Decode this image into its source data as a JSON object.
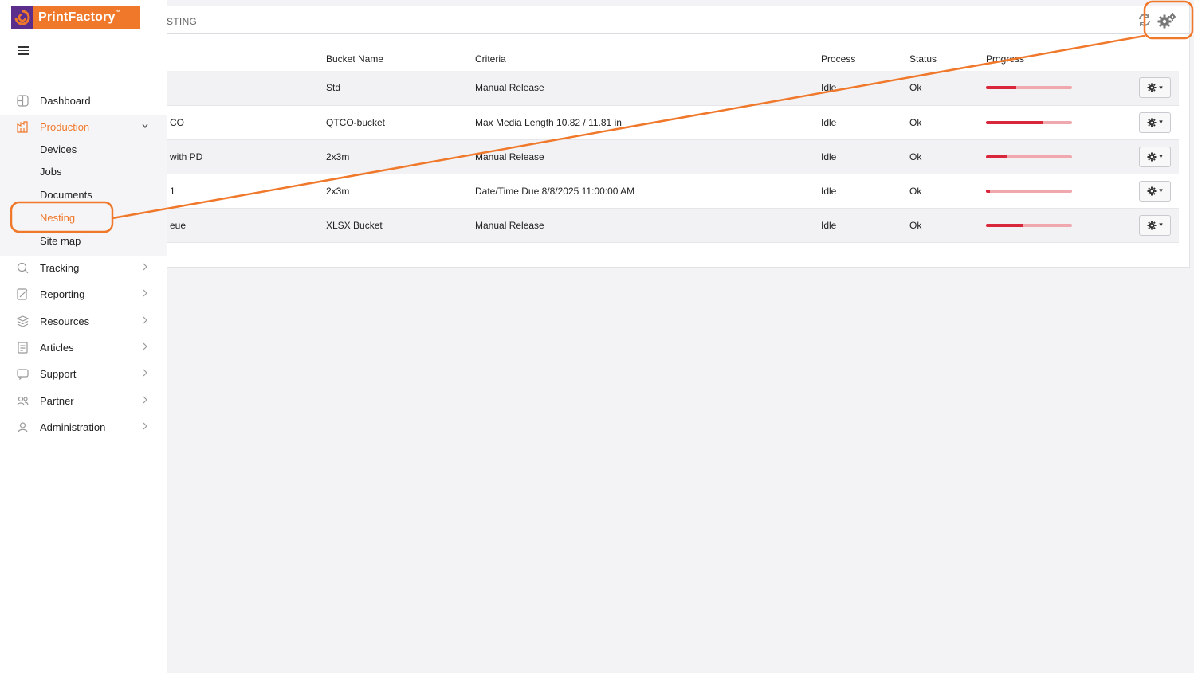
{
  "brand": {
    "name": "PrintFactory",
    "tm": "™",
    "orange": "#f0782b",
    "purple": "#5b2e8c"
  },
  "breadcrumb": "STING",
  "toolbar": {
    "refresh_icon": "refresh-icon",
    "settings_icon": "gears-icon"
  },
  "table": {
    "headers": [
      "Bucket Name",
      "Criteria",
      "Process",
      "Status",
      "Progress"
    ],
    "rows": [
      {
        "name": "",
        "bucket": "Std",
        "criteria": "Manual Release",
        "process": "Idle",
        "status": "Ok",
        "progress": 0.35
      },
      {
        "name": "CO",
        "bucket": "QTCO-bucket",
        "criteria": "Max Media Length 10.82 / 11.81 in",
        "process": "Idle",
        "status": "Ok",
        "progress": 0.67
      },
      {
        "name": "with PD",
        "bucket": "2x3m",
        "criteria": "Manual Release",
        "process": "Idle",
        "status": "Ok",
        "progress": 0.25
      },
      {
        "name": "1",
        "bucket": "2x3m",
        "criteria": "Date/Time Due 8/8/2025 11:00:00 AM",
        "process": "Idle",
        "status": "Ok",
        "progress": 0.05
      },
      {
        "name": "eue",
        "bucket": "XLSX Bucket",
        "criteria": "Manual Release",
        "process": "Idle",
        "status": "Ok",
        "progress": 0.43
      }
    ]
  },
  "sidebar": {
    "items": [
      {
        "label": "Dashboard",
        "icon": "dashboard-icon"
      },
      {
        "label": "Production",
        "icon": "production-icon",
        "expanded": true
      },
      {
        "label": "Tracking",
        "icon": "tracking-icon"
      },
      {
        "label": "Reporting",
        "icon": "reporting-icon"
      },
      {
        "label": "Resources",
        "icon": "resources-icon"
      },
      {
        "label": "Articles",
        "icon": "articles-icon"
      },
      {
        "label": "Support",
        "icon": "support-icon"
      },
      {
        "label": "Partner",
        "icon": "partner-icon"
      },
      {
        "label": "Administration",
        "icon": "administration-icon"
      }
    ],
    "production_sub": [
      "Devices",
      "Jobs",
      "Documents",
      "Nesting",
      "Site map"
    ],
    "active_sub": "Nesting"
  },
  "colors": {
    "progress_fill": "#d8273b",
    "progress_track": "#f0a7ae",
    "annotation": "#f0782b"
  }
}
